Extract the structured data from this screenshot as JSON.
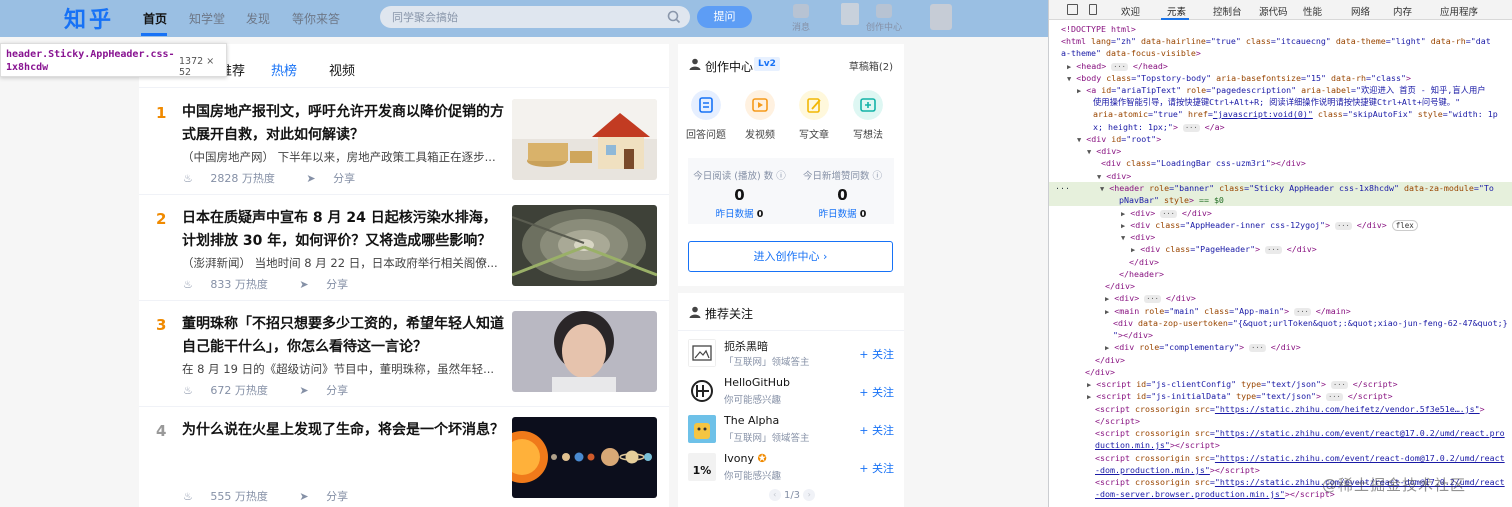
{
  "header": {
    "logo": "知乎",
    "nav": [
      "首页",
      "知学堂",
      "发现",
      "等你来答"
    ],
    "search_placeholder": "同学聚会搞始",
    "ask_button": "提问",
    "icons": [
      {
        "name": "notification",
        "label": "消息"
      },
      {
        "name": "creator-center",
        "label": "创作中心"
      }
    ]
  },
  "tooltip": {
    "selector": "header.Sticky.AppHeader.css-1x8hcdw",
    "size": "1372 × 52"
  },
  "feed": {
    "tabs": [
      "推荐",
      "热榜",
      "视频"
    ],
    "active_tab": "热榜",
    "items": [
      {
        "rank": "1",
        "title": "中国房地产报刊文，呼吁允许开发商以降价促销的方式展开自救，对此如何解读？",
        "excerpt": "（中国房地产网） 下半年以来，房地产政策工具箱正在逐步...",
        "heat": "2828 万热度",
        "share": "分享"
      },
      {
        "rank": "2",
        "title": "日本在质疑声中宣布 8 月 24 日起核污染水排海，计划排放 30 年，如何评价？又将造成哪些影响？",
        "excerpt": "（澎湃新闻） 当地时间 8 月 22 日，日本政府举行相关阁僚...",
        "heat": "833 万热度",
        "share": "分享"
      },
      {
        "rank": "3",
        "title": "董明珠称「不招只想要多少工资的，希望年轻人知道自己能干什么」，你怎么看待这一言论？",
        "excerpt": "在 8 月 19 日的《超级访问》节目中，董明珠称，虽然年轻...",
        "heat": "672 万热度",
        "share": "分享"
      },
      {
        "rank": "4",
        "title": "为什么说在火星上发现了生命，将会是一个坏消息？",
        "excerpt": "",
        "heat": "555 万热度",
        "share": "分享"
      }
    ]
  },
  "creator": {
    "title": "创作中心",
    "level": "Lv2",
    "drafts": "草稿箱(2)",
    "tools": [
      "回答问题",
      "发视频",
      "写文章",
      "写想法"
    ],
    "stats": [
      {
        "label": "今日阅读 (播放) 数",
        "value": "0",
        "sub_label": "昨日数据",
        "sub_value": "0"
      },
      {
        "label": "今日新增赞同数",
        "value": "0",
        "sub_label": "昨日数据",
        "sub_value": "0"
      }
    ],
    "enter_button": "进入创作中心"
  },
  "follow": {
    "title": "推荐关注",
    "items": [
      {
        "name": "扼杀黑暗",
        "desc": "「互联网」领域答主",
        "button": "关注"
      },
      {
        "name": "HelloGitHub",
        "desc": "你可能感兴趣",
        "button": "关注"
      },
      {
        "name": "The Alpha",
        "desc": "「互联网」领域答主",
        "button": "关注"
      },
      {
        "name": "Ivony",
        "desc": "你可能感兴趣",
        "button": "关注"
      }
    ],
    "pager": "1/3",
    "ivony_avatar_text": "1%"
  },
  "devtools": {
    "tabs": [
      "欢迎",
      "元素",
      "控制台",
      "源代码",
      "性能",
      "网络",
      "内存",
      "应用程序"
    ],
    "active_tab": "元素"
  },
  "watermark": "@稀土掘金技术社区"
}
